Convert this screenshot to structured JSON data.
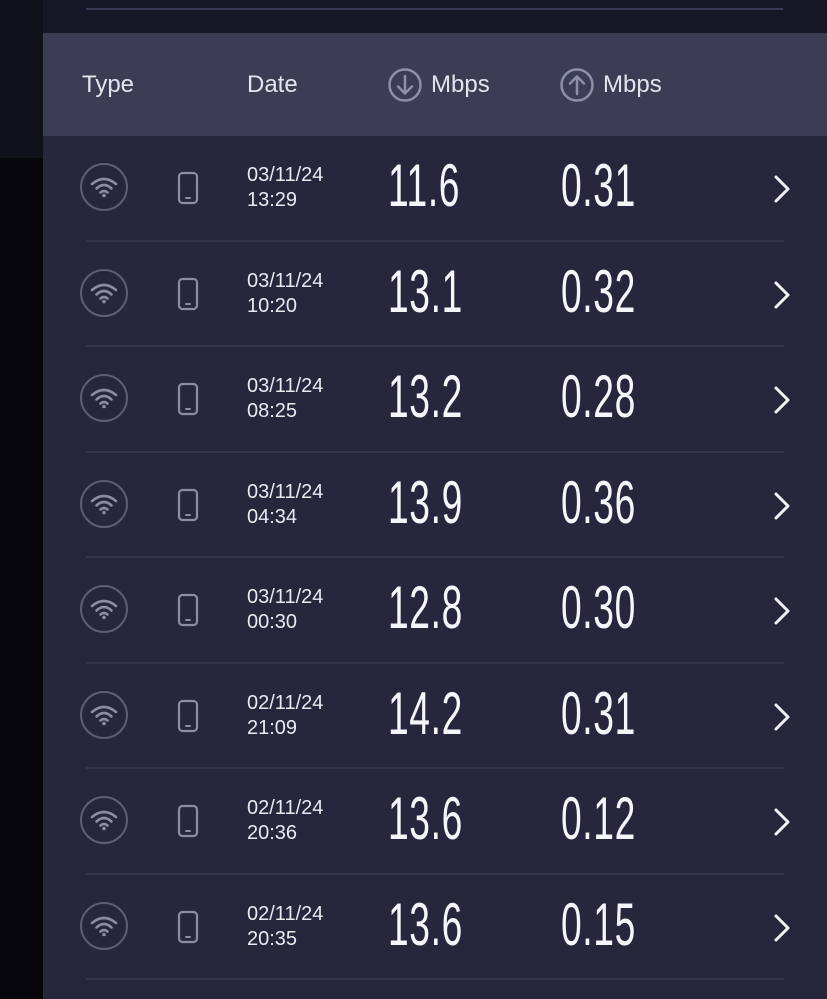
{
  "header": {
    "type_label": "Type",
    "date_label": "Date",
    "download_label": "Mbps",
    "upload_label": "Mbps",
    "download_icon": "arrow-down-circle-icon",
    "upload_icon": "arrow-up-circle-icon"
  },
  "rows": [
    {
      "connection_icon": "wifi-icon",
      "device_icon": "phone-icon",
      "date": "03/11/24",
      "time": "13:29",
      "download": "11.6",
      "upload": "0.31"
    },
    {
      "connection_icon": "wifi-icon",
      "device_icon": "phone-icon",
      "date": "03/11/24",
      "time": "10:20",
      "download": "13.1",
      "upload": "0.32"
    },
    {
      "connection_icon": "wifi-icon",
      "device_icon": "phone-icon",
      "date": "03/11/24",
      "time": "08:25",
      "download": "13.2",
      "upload": "0.28"
    },
    {
      "connection_icon": "wifi-icon",
      "device_icon": "phone-icon",
      "date": "03/11/24",
      "time": "04:34",
      "download": "13.9",
      "upload": "0.36"
    },
    {
      "connection_icon": "wifi-icon",
      "device_icon": "phone-icon",
      "date": "03/11/24",
      "time": "00:30",
      "download": "12.8",
      "upload": "0.30"
    },
    {
      "connection_icon": "wifi-icon",
      "device_icon": "phone-icon",
      "date": "02/11/24",
      "time": "21:09",
      "download": "14.2",
      "upload": "0.31"
    },
    {
      "connection_icon": "wifi-icon",
      "device_icon": "phone-icon",
      "date": "02/11/24",
      "time": "20:36",
      "download": "13.6",
      "upload": "0.12"
    },
    {
      "connection_icon": "wifi-icon",
      "device_icon": "phone-icon",
      "date": "02/11/24",
      "time": "20:35",
      "download": "13.6",
      "upload": "0.15"
    }
  ],
  "colors": {
    "panel_bg": "#26263d",
    "header_bg": "#3a3d54",
    "text": "#f2f3f8",
    "icon_stroke": "#5c5e74"
  }
}
